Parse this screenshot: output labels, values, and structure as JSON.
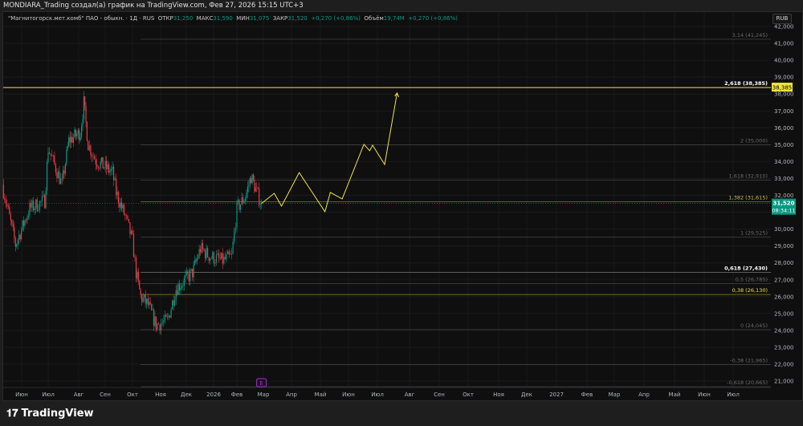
{
  "title": "MONDIARA_Trading создал(а) график на TradingView.com, Фев 27, 2026 15:15 UTC+3",
  "legend": {
    "symbol": "\"Магнитогорск.мет.комб\" ПАО - обыкн. · 1Д · RUS",
    "open_label": "ОТКР",
    "open": "31,250",
    "high_label": "МАКС",
    "high": "31,590",
    "low_label": "МИН",
    "low": "31,075",
    "close_label": "ЗАКР",
    "close": "31,520",
    "change": "+0,270 (+0,86%)",
    "volume_label": "Объём",
    "volume": "19,74M",
    "volume_change": "+0,270 (+0,86%)"
  },
  "currency_button": "RUB",
  "colors": {
    "up": "#089981",
    "down": "#f23645",
    "fib_yellow": "#f0e442",
    "wave": "#f0e442",
    "earnings": "#b02bd6"
  },
  "price_badge": {
    "price": "31,520",
    "countdown": "08:34:11"
  },
  "target_badge": "38,385",
  "earnings_marker": "E",
  "footer": {
    "logo_text": "TradingView"
  },
  "chart_data": {
    "type": "candlestick",
    "y_axis": {
      "range": [
        21000,
        42000
      ],
      "ticks": [
        21000,
        22000,
        23000,
        24000,
        25000,
        26000,
        27000,
        28000,
        29000,
        30000,
        31000,
        32000,
        33000,
        34000,
        35000,
        36000,
        37000,
        38000,
        39000,
        40000,
        41000,
        42000
      ],
      "tick_labels": [
        "21,000",
        "22,000",
        "23,000",
        "24,000",
        "25,000",
        "26,000",
        "27,000",
        "28,000",
        "29,000",
        "30,000",
        "31,000",
        "32,000",
        "33,000",
        "34,000",
        "35,000",
        "36,000",
        "37,000",
        "38,000",
        "39,000",
        "40,000",
        "41,000",
        "42,000"
      ]
    },
    "x_axis": {
      "ticks": [
        {
          "date": "2025-06-01",
          "label": "Июн"
        },
        {
          "date": "2025-07-01",
          "label": "Июл"
        },
        {
          "date": "2025-08-01",
          "label": "Авг"
        },
        {
          "date": "2025-09-01",
          "label": "Сен"
        },
        {
          "date": "2025-10-01",
          "label": "Окт"
        },
        {
          "date": "2025-11-01",
          "label": "Ноя"
        },
        {
          "date": "2025-12-01",
          "label": "Дек"
        },
        {
          "date": "2026-01-01",
          "label": "2026"
        },
        {
          "date": "2026-02-01",
          "label": "Фев"
        },
        {
          "date": "2026-03-01",
          "label": "Мар"
        },
        {
          "date": "2026-04-01",
          "label": "Апр"
        },
        {
          "date": "2026-05-01",
          "label": "Май"
        },
        {
          "date": "2026-06-01",
          "label": "Июн"
        },
        {
          "date": "2026-07-01",
          "label": "Июл"
        },
        {
          "date": "2026-08-01",
          "label": "Авг"
        },
        {
          "date": "2026-09-01",
          "label": "Сен"
        },
        {
          "date": "2026-10-01",
          "label": "Окт"
        },
        {
          "date": "2026-11-01",
          "label": "Ноя"
        },
        {
          "date": "2026-12-01",
          "label": "Дек"
        },
        {
          "date": "2027-01-01",
          "label": "2027"
        },
        {
          "date": "2027-02-01",
          "label": "Фев"
        },
        {
          "date": "2027-03-01",
          "label": "Мар"
        },
        {
          "date": "2027-04-01",
          "label": "Апр"
        },
        {
          "date": "2027-05-01",
          "label": "Май"
        },
        {
          "date": "2027-06-01",
          "label": "Июн"
        },
        {
          "date": "2027-07-01",
          "label": "Июл"
        }
      ]
    },
    "price_path": [
      [
        "2025-05-10",
        32640
      ],
      [
        "2025-05-25",
        29080
      ],
      [
        "2025-06-10",
        31220
      ],
      [
        "2025-06-27",
        31690
      ],
      [
        "2025-07-01",
        34780
      ],
      [
        "2025-07-15",
        32640
      ],
      [
        "2025-07-22",
        35250
      ],
      [
        "2025-08-03",
        35730
      ],
      [
        "2025-08-07",
        37490
      ],
      [
        "2025-08-12",
        35020
      ],
      [
        "2025-08-21",
        34070
      ],
      [
        "2025-09-09",
        33350
      ],
      [
        "2025-09-13",
        32170
      ],
      [
        "2025-09-23",
        30740
      ],
      [
        "2025-10-01",
        29320
      ],
      [
        "2025-10-05",
        27420
      ],
      [
        "2025-10-10",
        25990
      ],
      [
        "2025-10-18",
        25520
      ],
      [
        "2025-10-27",
        24330
      ],
      [
        "2025-11-09",
        24570
      ],
      [
        "2025-11-19",
        26470
      ],
      [
        "2025-12-08",
        27420
      ],
      [
        "2025-12-17",
        28840
      ],
      [
        "2025-12-28",
        28370
      ],
      [
        "2026-01-13",
        28130
      ],
      [
        "2026-01-25",
        28370
      ],
      [
        "2026-02-01",
        31220
      ],
      [
        "2026-02-10",
        31930
      ],
      [
        "2026-02-16",
        33120
      ],
      [
        "2026-02-22",
        32170
      ],
      [
        "2026-02-27",
        31520
      ]
    ],
    "last_price": 31520,
    "wave_projection": [
      [
        "2026-02-27",
        31520
      ],
      [
        "2026-03-13",
        32120
      ],
      [
        "2026-03-21",
        31360
      ],
      [
        "2026-04-09",
        33350
      ],
      [
        "2026-05-06",
        31030
      ],
      [
        "2026-05-12",
        32170
      ],
      [
        "2026-05-25",
        31790
      ],
      [
        "2026-06-17",
        35020
      ],
      [
        "2026-06-23",
        34640
      ],
      [
        "2026-06-26",
        34970
      ],
      [
        "2026-07-08",
        33830
      ],
      [
        "2026-07-20",
        38060
      ]
    ],
    "fib_levels": [
      {
        "ratio": "3,14",
        "price": 41245,
        "label": "3,14 (41,245)",
        "color": "#6b6b6b"
      },
      {
        "ratio": "2,618",
        "price": 38385,
        "label": "2,618 (38,385)",
        "color": "#f0e442",
        "text_color": "#ffffff",
        "full_width": true
      },
      {
        "ratio": "2",
        "price": 35000,
        "label": "2 (35,000)",
        "color": "#6b6b6b"
      },
      {
        "ratio": "1,618",
        "price": 32910,
        "label": "1,618 (32,910)",
        "color": "#6b6b6b"
      },
      {
        "ratio": "1,382",
        "price": 31615,
        "label": "1,382 (31,615)",
        "color": "#c9bb55"
      },
      {
        "ratio": "1",
        "price": 29525,
        "label": "1 (29,525)",
        "color": "#6b6b6b"
      },
      {
        "ratio": "0,618",
        "price": 27430,
        "label": "0,618 (27,430)",
        "color": "#bdbdbd",
        "text_color": "#ffffff"
      },
      {
        "ratio": "0,5",
        "price": 26785,
        "label": "0,5 (26,785)",
        "color": "#6b6b6b"
      },
      {
        "ratio": "0,38",
        "price": 26130,
        "label": "0,38 (26,130)",
        "color": "#f0e442"
      },
      {
        "ratio": "0",
        "price": 24045,
        "label": "0 (24,045)",
        "color": "#6b6b6b"
      },
      {
        "ratio": "-0,38",
        "price": 21965,
        "label": "-0,38 (21,965)",
        "color": "#6b6b6b"
      },
      {
        "ratio": "-0,618",
        "price": 20665,
        "label": "-0,618 (20,665)",
        "color": "#6b6b6b"
      }
    ]
  }
}
